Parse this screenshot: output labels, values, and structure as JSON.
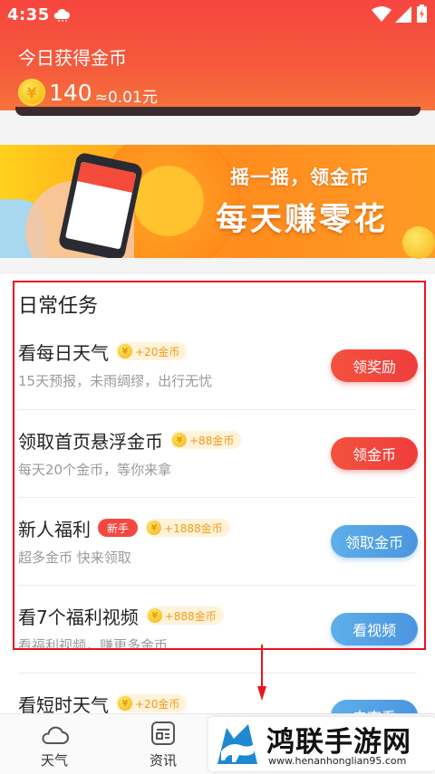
{
  "status_bar": {
    "time": "4:35"
  },
  "header": {
    "today_title": "今日获得金币",
    "coin_symbol": "¥",
    "coin_count": "140",
    "coin_approx": "≈0.01元"
  },
  "banner": {
    "line1": "摇一摇，领金币",
    "line2": "每天赚零花"
  },
  "tasks": {
    "section_title": "日常任务",
    "items": [
      {
        "title": "看每日天气",
        "badge": "",
        "reward": "+20金币",
        "desc": "15天预报，未雨绸缪，出行无忧",
        "button": "领奖励",
        "button_style": "red"
      },
      {
        "title": "领取首页悬浮金币",
        "badge": "",
        "reward": "+88金币",
        "desc": "每天20个金币，等你来拿",
        "button": "领金币",
        "button_style": "red"
      },
      {
        "title": "新人福利",
        "badge": "新手",
        "reward": "+1888金币",
        "desc": "超多金币 快来领取",
        "button": "领取金币",
        "button_style": "blue"
      },
      {
        "title": "看7个福利视频",
        "badge": "",
        "reward": "+888金币",
        "desc": "看福利视频，赚更多金币",
        "button": "看视频",
        "button_style": "blue"
      },
      {
        "title": "看短时天气",
        "badge": "",
        "reward": "+20金币",
        "desc": "",
        "button": "去查看",
        "button_style": "blue"
      }
    ]
  },
  "bottom_nav": {
    "items": [
      {
        "label": "天气",
        "icon": "cloud-icon"
      },
      {
        "label": "资讯",
        "icon": "news-icon"
      }
    ]
  },
  "watermark": {
    "title": "鸿联手游网",
    "url": "www.henanhonglian95.com"
  },
  "colors": {
    "header_red": "#f7463f",
    "button_red": "#f4523e",
    "button_blue": "#5dafe9",
    "highlight_red": "#e8141e",
    "reward_orange": "#f39a1b"
  }
}
